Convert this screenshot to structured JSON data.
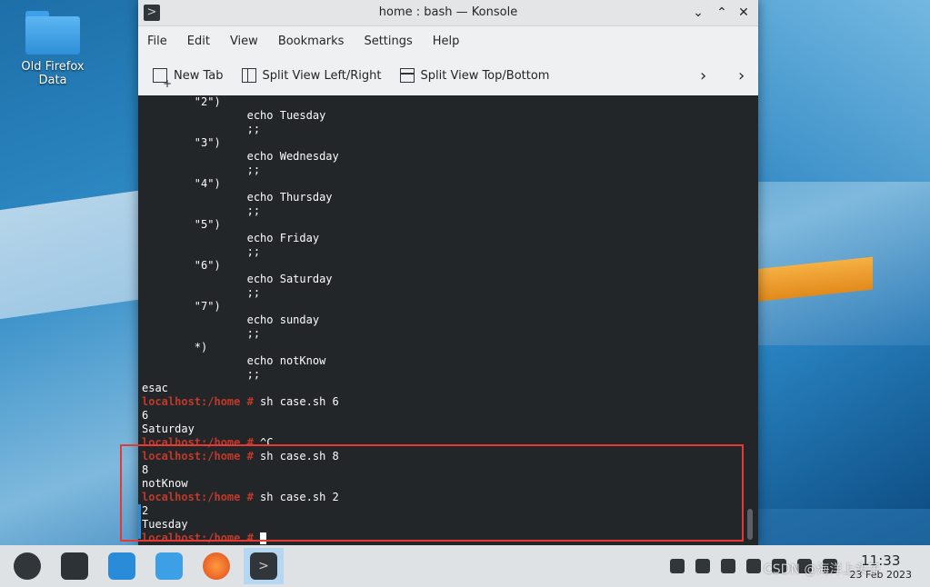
{
  "desktop": {
    "icon_label": "Old Firefox Data"
  },
  "window": {
    "title": "home : bash — Konsole",
    "menu": [
      "File",
      "Edit",
      "View",
      "Bookmarks",
      "Settings",
      "Help"
    ],
    "toolbar": {
      "new_tab": "New Tab",
      "split_lr": "Split View Left/Right",
      "split_tb": "Split View Top/Bottom"
    }
  },
  "terminal": {
    "lines": [
      {
        "text": "        \"2\")"
      },
      {
        "text": "                echo Tuesday"
      },
      {
        "text": "                ;;"
      },
      {
        "text": "        \"3\")"
      },
      {
        "text": "                echo Wednesday"
      },
      {
        "text": "                ;;"
      },
      {
        "text": "        \"4\")"
      },
      {
        "text": "                echo Thursday"
      },
      {
        "text": "                ;;"
      },
      {
        "text": "        \"5\")"
      },
      {
        "text": "                echo Friday"
      },
      {
        "text": "                ;;"
      },
      {
        "text": "        \"6\")"
      },
      {
        "text": "                echo Saturday"
      },
      {
        "text": "                ;;"
      },
      {
        "text": "        \"7\")"
      },
      {
        "text": "                echo sunday"
      },
      {
        "text": "                ;;"
      },
      {
        "text": "        *)"
      },
      {
        "text": "                echo notKnow"
      },
      {
        "text": "                ;;"
      },
      {
        "text": "esac"
      },
      {
        "prompt": "localhost:/home # ",
        "text": "sh case.sh 6"
      },
      {
        "text": "6"
      },
      {
        "text": "Saturday"
      },
      {
        "prompt": "localhost:/home # ",
        "text": "^C"
      },
      {
        "prompt": "localhost:/home # ",
        "text": "sh case.sh 8"
      },
      {
        "text": "8"
      },
      {
        "text": "notKnow"
      },
      {
        "prompt": "localhost:/home # ",
        "text": "sh case.sh 2"
      },
      {
        "text": "2"
      },
      {
        "text": "Tuesday"
      },
      {
        "prompt": "localhost:/home # ",
        "text": "",
        "cursor": true
      }
    ]
  },
  "taskbar": {
    "items": [
      "start-menu-icon",
      "system-settings-icon",
      "discover-icon",
      "file-manager-icon",
      "firefox-icon",
      "konsole-icon"
    ],
    "time": "11:33",
    "date": "23 Feb 2023",
    "watermark": "CSDN @海洋上头子"
  },
  "colors": {
    "prompt": "#c0392b",
    "terminal_bg": "#232629",
    "highlight": "#e53935"
  }
}
